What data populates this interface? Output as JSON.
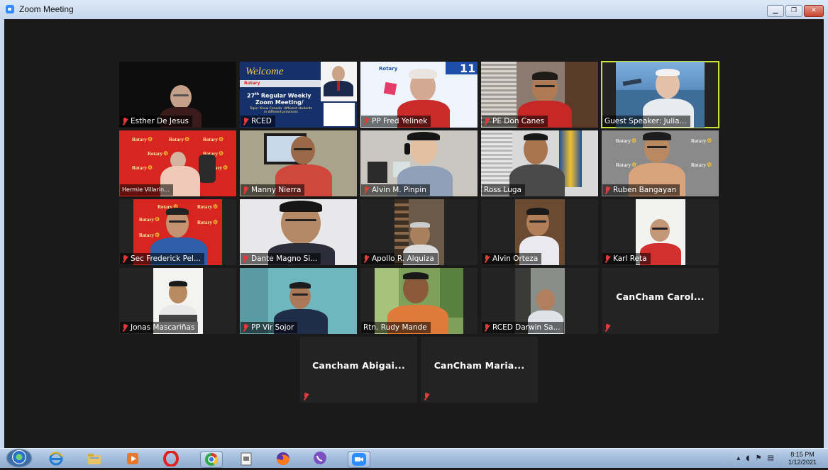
{
  "window": {
    "title": "Zoom Meeting",
    "buttons": [
      "minimize",
      "maximize",
      "close"
    ]
  },
  "participants": [
    {
      "name": "Esther De Jesus"
    },
    {
      "name": "RCED"
    },
    {
      "name": "PP Fred Yelinek"
    },
    {
      "name": "PE Don Canes"
    },
    {
      "name": "Guest Speaker: Julia...",
      "active_speaker": true
    },
    {
      "name": "Hermie Villarin..."
    },
    {
      "name": "Manny Nierra"
    },
    {
      "name": "Alvin M. Pinpin"
    },
    {
      "name": "Ross Luga"
    },
    {
      "name": "Ruben Bangayan"
    },
    {
      "name": "Sec Frederick Pel..."
    },
    {
      "name": "Dante Magno Si..."
    },
    {
      "name": "Apollo R. Alquiza"
    },
    {
      "name": "Alvin Orteza"
    },
    {
      "name": "Karl Reta"
    },
    {
      "name": "Jonas Mascariñas"
    },
    {
      "name": "PP Vir Sojor"
    },
    {
      "name": "Rtn. Rudy Mande"
    },
    {
      "name": "RCED Darwin Sa..."
    },
    {
      "name": "CanCham  Carol...",
      "video": false
    },
    {
      "name": "Cancham  Abigai...",
      "video": false
    },
    {
      "name": "CanCham  Maria...",
      "video": false
    }
  ],
  "rced_slide": {
    "welcome": "Welcome",
    "line1": "27",
    "line1_sup": "th",
    "line1_rest": " Regular Weekly",
    "line2": "Zoom Meeting/",
    "topic": "Topic: Know Canada: different students in different provinces"
  },
  "fred_slide": {
    "number": "11"
  },
  "rotary_label": "Rotary",
  "taskbar": {
    "apps": [
      "start-orb",
      "internet-explorer",
      "file-explorer",
      "media-player",
      "opera",
      "chrome",
      "document",
      "firefox",
      "viber",
      "zoom"
    ],
    "time": "8:15 PM",
    "date": "1/12/2021"
  },
  "colors": {
    "active_border": "#c9e03a",
    "muted_mic": "#e23b3b",
    "rotary_red": "#d8251f"
  }
}
